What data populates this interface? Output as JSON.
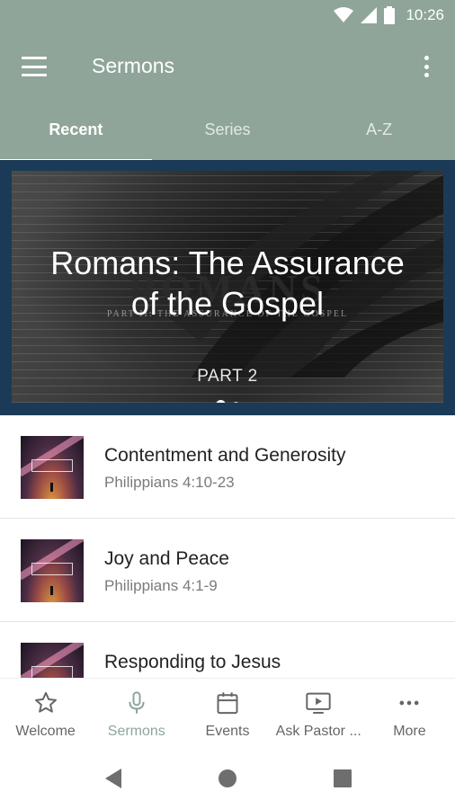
{
  "status_bar": {
    "time": "10:26",
    "icons": [
      "wifi-icon",
      "signal-icon",
      "battery-icon"
    ]
  },
  "app_bar": {
    "title": "Sermons",
    "menu_icon": "hamburger-menu-icon",
    "overflow_icon": "more-vert-icon",
    "background_color": "#8fa599"
  },
  "tabs": [
    {
      "label": "Recent",
      "active": true
    },
    {
      "label": "Series",
      "active": false
    },
    {
      "label": "A-Z",
      "active": false
    }
  ],
  "hero": {
    "title": "Romans: The Assurance of the Gospel",
    "subtitle": "PART 2",
    "background_word": "ROMANS",
    "background_subtitle": "PART II: THE ASSURANCE OF THE GOSPEL",
    "pager_page": 1,
    "pager_total": 2
  },
  "sermons": [
    {
      "title": "Contentment and Generosity",
      "subtitle": "Philippians 4:10-23"
    },
    {
      "title": "Joy and Peace",
      "subtitle": "Philippians 4:1-9"
    },
    {
      "title": "Responding to Jesus",
      "subtitle": ""
    }
  ],
  "bottom_nav": [
    {
      "label": "Welcome",
      "icon": "star-icon",
      "active": false
    },
    {
      "label": "Sermons",
      "icon": "microphone-icon",
      "active": true
    },
    {
      "label": "Events",
      "icon": "calendar-icon",
      "active": false
    },
    {
      "label": "Ask Pastor ...",
      "icon": "tv-play-icon",
      "active": false
    },
    {
      "label": "More",
      "icon": "more-horiz-icon",
      "active": false
    }
  ],
  "system_nav": [
    "back-icon",
    "home-icon",
    "recents-icon"
  ],
  "colors": {
    "accent": "#8fa599",
    "hero_frame": "#1b3a57"
  }
}
